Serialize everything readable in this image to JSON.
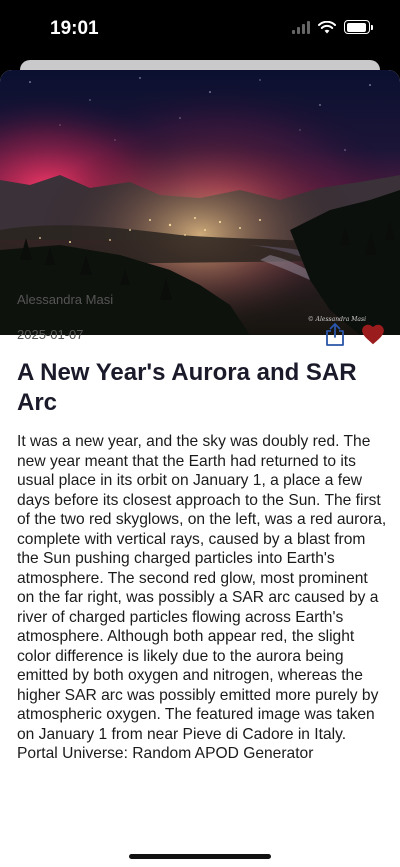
{
  "status_bar": {
    "time": "19:01"
  },
  "apod": {
    "image_alt": "Aurora and SAR arc over a mountain valley town at night",
    "image_watermark": "© Alessandra Masi",
    "copyright": "Alessandra Masi",
    "date": "2025-01-07",
    "title": "A New Year's Aurora and SAR Arc",
    "explanation": "It was a new year, and the sky was doubly red. The new year meant that the Earth had returned to its usual place in its orbit on January 1, a place a few days before its closest approach to the Sun. The first of the two red skyglows, on the left, was a red aurora, complete with vertical rays, caused by a blast from the Sun pushing charged particles into Earth's atmosphere.  The second red glow, most prominent on the far right, was possibly a SAR arc caused by a river of charged particles flowing across Earth's atmosphere.  Although both appear red, the slight color difference is likely due to the aurora being emitted by both oxygen and nitrogen, whereas the higher SAR arc was possibly emitted more purely by atmospheric oxygen. The featured image was taken on January 1 from near Pieve di Cadore in Italy.  Portal Universe: Random APOD Generator"
  },
  "actions": {
    "share_icon": "share-icon",
    "favorite_icon": "heart-filled-icon",
    "favorite_color": "#9b1c1c"
  }
}
